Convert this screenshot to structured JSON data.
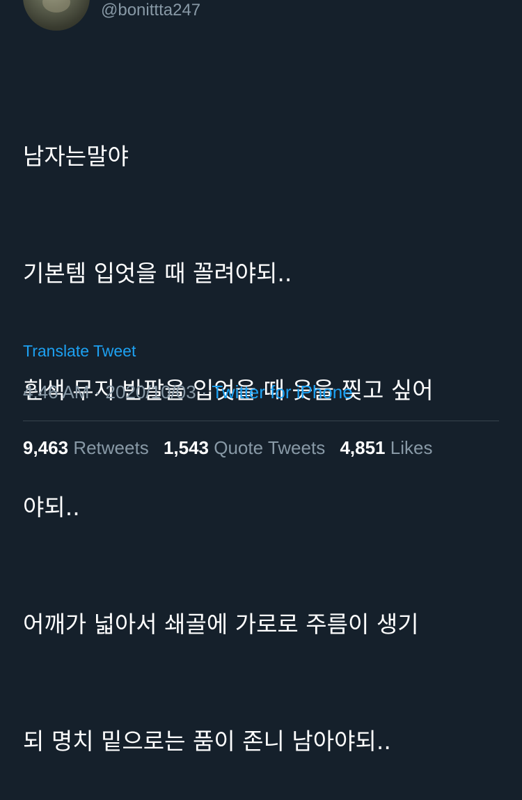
{
  "author": {
    "handle": "@bonittta247",
    "avatar_icon": "cat-photo-avatar"
  },
  "tweet": {
    "lines": [
      "남자는말야",
      "기본템 입엇을 때 꼴려야되..",
      "흰색 무지 반팔을 입엇을 때 옷을 찢고 싶어",
      "야되..",
      "어깨가 넓아서 쇄골에 가로로 주름이 생기",
      "되 명치 밑으로는 품이 존니 남아야되.."
    ],
    "translate_label": "Translate Tweet",
    "time": "4:46 AM",
    "separator": "·",
    "date": "2020/10/03",
    "source": "Twitter for iPhone"
  },
  "stats": {
    "retweets": {
      "count": "9,463",
      "label": "Retweets"
    },
    "quote_tweets": {
      "count": "1,543",
      "label": "Quote Tweets"
    },
    "likes": {
      "count": "4,851",
      "label": "Likes"
    }
  },
  "colors": {
    "background": "#15202b",
    "text": "#ffffff",
    "secondary": "#8899a6",
    "accent": "#1da1f2",
    "divider": "#38444d"
  }
}
